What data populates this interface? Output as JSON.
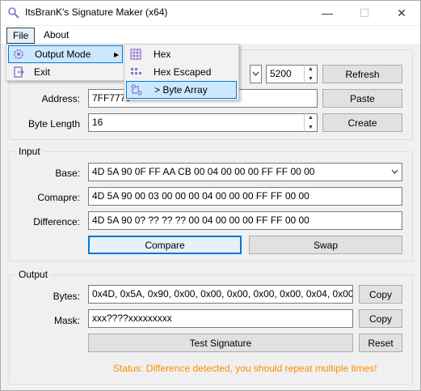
{
  "window": {
    "title": "ItsBranK's Signature Maker (x64)"
  },
  "titlebar": {
    "minimize": "—",
    "maximize": "☐",
    "close": "✕"
  },
  "menubar": {
    "file": "File",
    "about": "About"
  },
  "file_menu": {
    "output_mode": "Output Mode",
    "exit": "Exit",
    "submenu_arrow": "▶"
  },
  "output_menu": {
    "hex": "Hex",
    "hex_escaped": "Hex Escaped",
    "byte_array": "> Byte Array"
  },
  "process": {
    "pid_value": "5200",
    "refresh": "Refresh",
    "address_label": "Address:",
    "address_value": "7FF7779",
    "paste": "Paste",
    "byte_length_label": "Byte Length",
    "byte_length_value": "16",
    "create": "Create"
  },
  "input": {
    "group_label": "Input",
    "base_label": "Base:",
    "base_value": "4D 5A 90 0F FF AA CB 00 04 00 00 00 FF FF 00 00",
    "compare_label": "Comapre:",
    "compare_value": "4D 5A 90 00 03 00 00 00 04 00 00 00 FF FF 00 00",
    "difference_label": "Difference:",
    "difference_value": "4D 5A 90 0? ?? ?? ?? 00 04 00 00 00 FF FF 00 00",
    "compare_button": "Compare",
    "swap_button": "Swap"
  },
  "output": {
    "group_label": "Output",
    "bytes_label": "Bytes:",
    "bytes_value": "0x4D, 0x5A, 0x90, 0x00, 0x00, 0x00, 0x00, 0x00, 0x04, 0x00",
    "copy": "Copy",
    "mask_label": "Mask:",
    "mask_value": "xxx????xxxxxxxxx",
    "copy2": "Copy",
    "test_signature": "Test Signature",
    "reset": "Reset",
    "status": "Status: Difference detected, you should repeat multiple times!"
  },
  "colors": {
    "accent": "#0078d7",
    "status": "#ff8c00",
    "highlight": "#cce8ff"
  },
  "icons": {
    "app": "magnifier-icon",
    "output_mode": "gear-icon",
    "exit": "exit-icon",
    "hex": "grid-icon",
    "hex_escaped": "dots-icon",
    "byte_array": "array-icon"
  }
}
